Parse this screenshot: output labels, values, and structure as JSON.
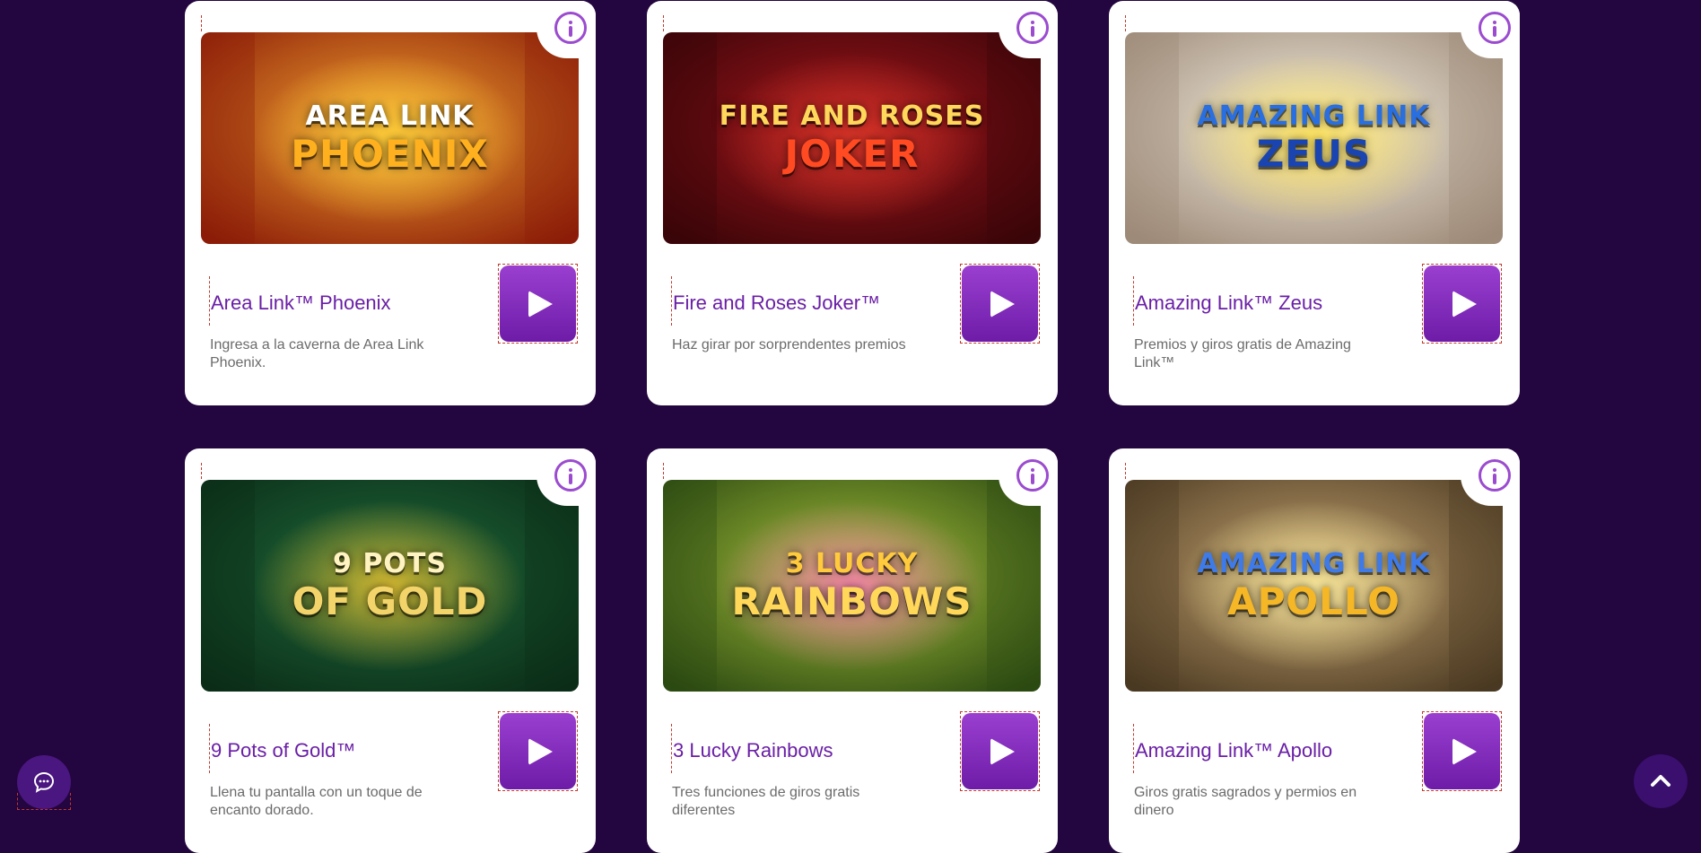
{
  "games": [
    {
      "title": "Area Link™ Phoenix",
      "description": "Ingresa a la caverna de Area Link Phoenix.",
      "art_line1": "AREA LINK",
      "art_line2": "PHOENIX",
      "colors": {
        "bg1": "#f2a431",
        "bg2": "#8c1d08",
        "accent": "#ffd23a",
        "text1": "#ffffff",
        "text2": "#ffb01e"
      }
    },
    {
      "title": "Fire and Roses Joker™",
      "description": "Haz girar por sorprendentes premios",
      "art_line1": "FIRE AND ROSES",
      "art_line2": "JOKER",
      "colors": {
        "bg1": "#a2151c",
        "bg2": "#3a0508",
        "accent": "#e03a2a",
        "text1": "#ffd75a",
        "text2": "#ff4a22"
      }
    },
    {
      "title": "Amazing Link™ Zeus",
      "description": "Premios y giros gratis de Amazing Link™",
      "art_line1": "AMAZING LINK",
      "art_line2": "ZEUS",
      "colors": {
        "bg1": "#f4f0e2",
        "bg2": "#9e8a78",
        "accent": "#ffe14a",
        "text1": "#2a6fe0",
        "text2": "#1a45b0"
      }
    },
    {
      "title": "9 Pots of Gold™",
      "description": "Llena tu pantalla con un toque de encanto dorado.",
      "art_line1": "9 POTS",
      "art_line2": "OF GOLD",
      "colors": {
        "bg1": "#1f6a3a",
        "bg2": "#0b2d18",
        "accent": "#f3c530",
        "text1": "#fff3c2",
        "text2": "#f3d46a"
      }
    },
    {
      "title": "3 Lucky Rainbows",
      "description": "Tres funciones de giros gratis diferentes",
      "art_line1": "3 LUCKY",
      "art_line2": "RAINBOWS",
      "colors": {
        "bg1": "#a7c23a",
        "bg2": "#2c4a12",
        "accent": "#ff7ab8",
        "text1": "#ffcb3c",
        "text2": "#ffd85a"
      }
    },
    {
      "title": "Amazing Link™ Apollo",
      "description": "Giros gratis sagrados y permios en dinero",
      "art_line1": "AMAZING LINK",
      "art_line2": "APOLLO",
      "colors": {
        "bg1": "#c7a572",
        "bg2": "#4b3a22",
        "accent": "#fff1a0",
        "text1": "#3f7be8",
        "text2": "#f5b726"
      }
    }
  ],
  "icons": {
    "info": "info-icon",
    "play": "play-icon",
    "chat": "chat-bubble-icon",
    "scroll_top": "chevron-up-icon"
  },
  "theme": {
    "page_bg": "#23053f",
    "title_color": "#6a1fa6",
    "play_color": "#8a2ec4"
  }
}
